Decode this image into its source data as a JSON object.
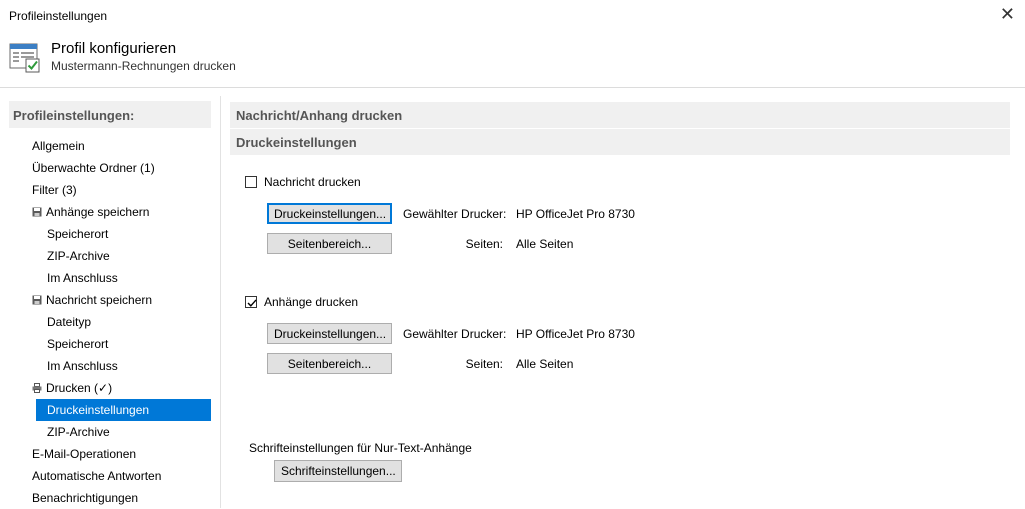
{
  "window": {
    "title": "Profileinstellungen",
    "close_glyph": "✕"
  },
  "header": {
    "icon": "profile-settings-icon",
    "title": "Profil konfigurieren",
    "subtitle": "Mustermann-Rechnungen drucken"
  },
  "sidebar": {
    "heading": "Profileinstellungen:",
    "items": [
      {
        "label": "Allgemein"
      },
      {
        "label": "Überwachte Ordner (1)"
      },
      {
        "label": "Filter (3)"
      },
      {
        "label": "Anhänge speichern",
        "icon": "save-icon"
      },
      {
        "label": "Speicherort"
      },
      {
        "label": "ZIP-Archive"
      },
      {
        "label": "Im Anschluss"
      },
      {
        "label": "Nachricht speichern",
        "icon": "save-icon"
      },
      {
        "label": "Dateityp"
      },
      {
        "label": "Speicherort"
      },
      {
        "label": "Im Anschluss"
      },
      {
        "label": "Drucken (✓)",
        "icon": "printer-icon"
      },
      {
        "label": "Druckeinstellungen",
        "selected": true
      },
      {
        "label": "ZIP-Archive"
      },
      {
        "label": "E-Mail-Operationen"
      },
      {
        "label": "Automatische Antworten"
      },
      {
        "label": "Benachrichtigungen"
      }
    ]
  },
  "main": {
    "section_title": "Nachricht/Anhang drucken",
    "subsection_title": "Druckeinstellungen",
    "message": {
      "checkbox_label": "Nachricht drucken",
      "checked": false,
      "settings_button": "Druckeinstellungen...",
      "printer_label": "Gewählter Drucker:",
      "printer_value": "HP OfficeJet Pro 8730",
      "range_button": "Seitenbereich...",
      "pages_label": "Seiten:",
      "pages_value": "Alle Seiten"
    },
    "attachments": {
      "checkbox_label": "Anhänge drucken",
      "checked": true,
      "settings_button": "Druckeinstellungen...",
      "printer_label": "Gewählter Drucker:",
      "printer_value": "HP OfficeJet Pro 8730",
      "range_button": "Seitenbereich...",
      "pages_label": "Seiten:",
      "pages_value": "Alle Seiten"
    },
    "font": {
      "label": "Schrifteinstellungen für Nur-Text-Anhänge",
      "button": "Schrifteinstellungen..."
    }
  },
  "colors": {
    "accent": "#0078d7",
    "section_bg": "#f0f0f0",
    "button_bg": "#e1e1e1"
  }
}
